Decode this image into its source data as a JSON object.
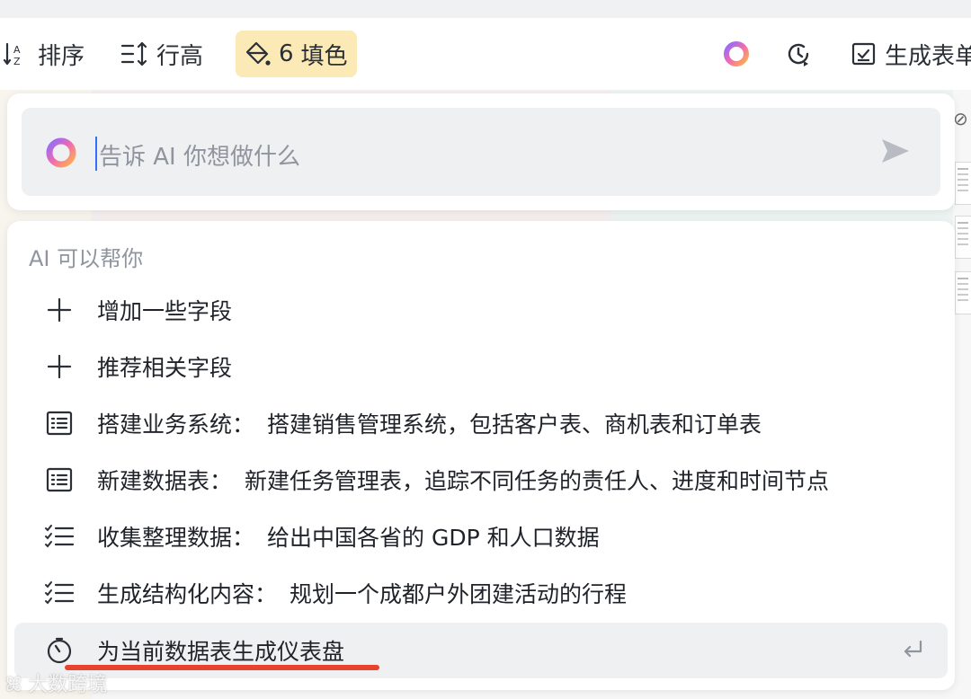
{
  "toolbar": {
    "sort_label": "排序",
    "row_height_label": "行高",
    "fill_count": "6",
    "fill_label": "填色",
    "form_label": "生成表单"
  },
  "prompt": {
    "placeholder": "告诉 AI 你想做什么"
  },
  "panel": {
    "heading": "AI 可以帮你",
    "suggestions": [
      {
        "icon": "plus-icon",
        "title": "增加一些字段",
        "detail": ""
      },
      {
        "icon": "plus-icon",
        "title": "推荐相关字段",
        "detail": ""
      },
      {
        "icon": "table-icon",
        "title": "搭建业务系统：",
        "detail": "搭建销售管理系统，包括客户表、商机表和订单表"
      },
      {
        "icon": "table-icon",
        "title": "新建数据表：",
        "detail": "新建任务管理表，追踪不同任务的责任人、进度和时间节点"
      },
      {
        "icon": "checklist-icon",
        "title": "收集整理数据：",
        "detail": "给出中国各省的 GDP 和人口数据"
      },
      {
        "icon": "checklist-icon",
        "title": "生成结构化内容：",
        "detail": "规划一个成都户外团建活动的行程"
      },
      {
        "icon": "dashboard-icon",
        "title": "为当前数据表生成仪表盘",
        "detail": ""
      }
    ]
  },
  "watermark": "大数跨境",
  "colors": {
    "fill_highlight": "#fbe9b6",
    "accent_caret": "#3370ff",
    "underline": "#e8432e"
  }
}
